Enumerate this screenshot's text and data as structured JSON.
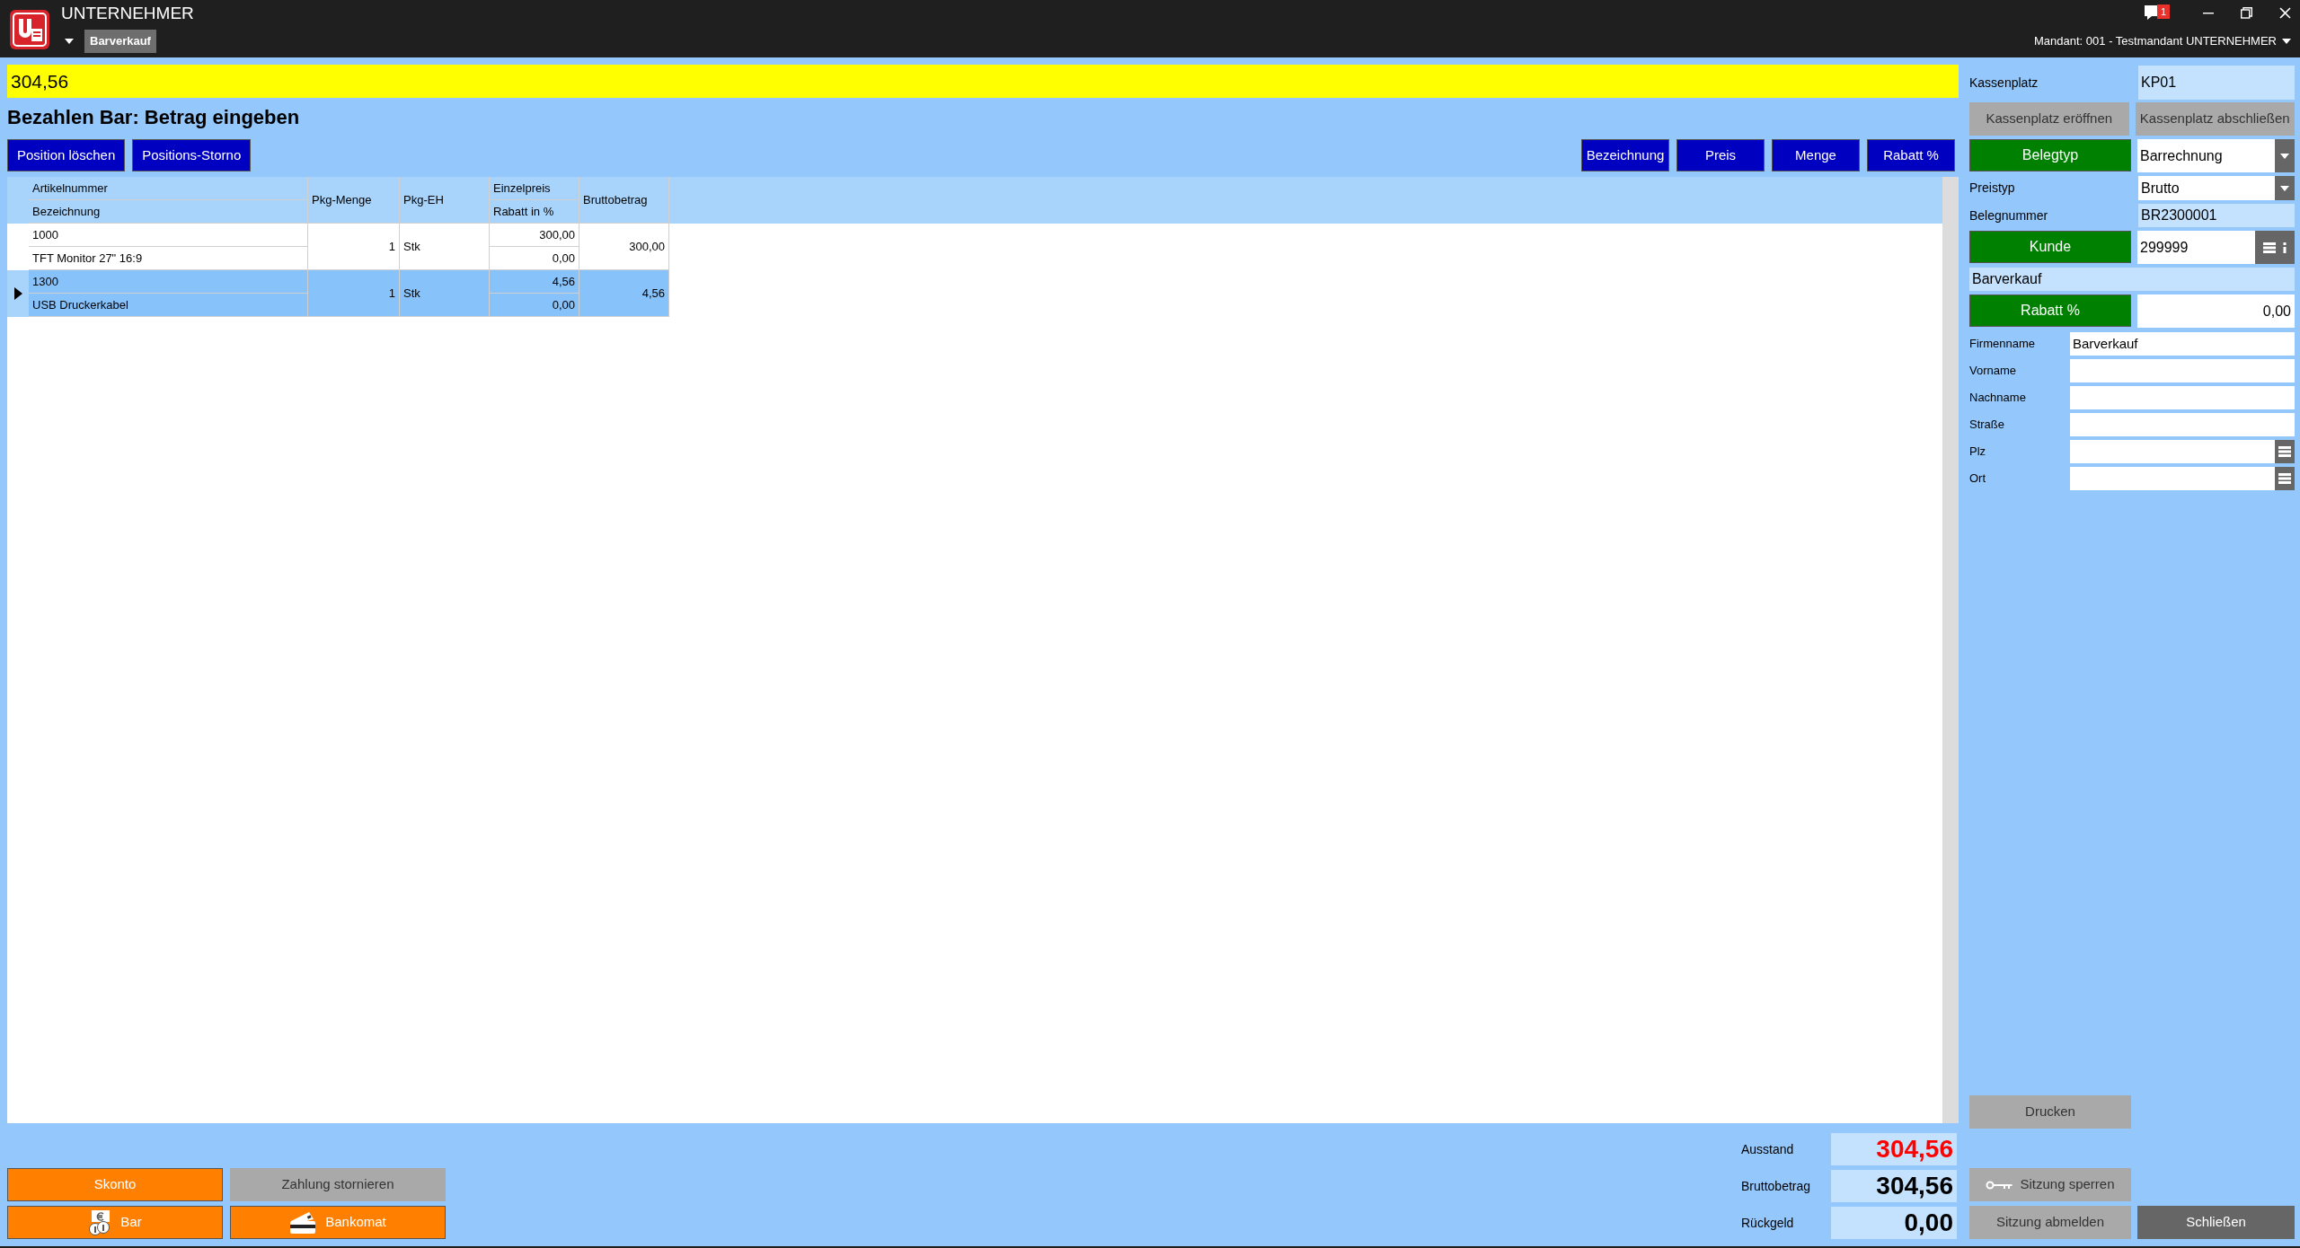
{
  "window": {
    "title": "UNTERNEHMER",
    "tab": "Barverkauf",
    "notification_count": "1",
    "mandant": "Mandant: 001 - Testmandant UNTERNEHMER"
  },
  "amount_input": {
    "value": "304,56"
  },
  "prompt": "Bezahlen Bar: Betrag eingeben",
  "position_buttons": [
    "Position löschen",
    "Positions-Storno"
  ],
  "sort_buttons": [
    "Bezeichnung",
    "Preis",
    "Menge",
    "Rabatt %"
  ],
  "table": {
    "columns": {
      "artikelnummer": "Artikelnummer",
      "bezeichnung": "Bezeichnung",
      "pkg_menge": "Pkg-Menge",
      "pkg_eh": "Pkg-EH",
      "einzelpreis": "Einzelpreis",
      "rabatt": "Rabatt in %",
      "bruttobetrag": "Bruttobetrag"
    },
    "rows": [
      {
        "artikelnummer": "1000",
        "bezeichnung": "TFT Monitor 27\" 16:9",
        "pkg_menge": "1",
        "pkg_eh": "Stk",
        "einzelpreis": "300,00",
        "rabatt": "0,00",
        "bruttobetrag": "300,00",
        "selected": false
      },
      {
        "artikelnummer": "1300",
        "bezeichnung": "USB Druckerkabel",
        "pkg_menge": "1",
        "pkg_eh": "Stk",
        "einzelpreis": "4,56",
        "rabatt": "0,00",
        "bruttobetrag": "4,56",
        "selected": true
      }
    ]
  },
  "payment_buttons": [
    {
      "label": "Skonto",
      "kind": "plain",
      "disabled": false
    },
    {
      "label": "Zahlung stornieren",
      "kind": "plain",
      "disabled": true
    },
    {
      "label": "Bar",
      "kind": "cash",
      "disabled": false
    },
    {
      "label": "Bankomat",
      "kind": "card",
      "disabled": false
    }
  ],
  "totals": [
    {
      "label": "Ausstand",
      "value": "304,56",
      "color": "#ff0000"
    },
    {
      "label": "Bruttobetrag",
      "value": "304,56",
      "color": "#000000"
    },
    {
      "label": "Rückgeld",
      "value": "0,00",
      "color": "#000000"
    }
  ],
  "side_panel": {
    "register": {
      "label": "Kassenplatz",
      "value": "KP01"
    },
    "register_buttons": [
      {
        "label": "Kassenplatz eröffnen",
        "disabled": true
      },
      {
        "label": "Kassenplatz abschließen",
        "disabled": true
      }
    ],
    "document_type": {
      "button": "Belegtyp",
      "value": "Barrechnung"
    },
    "price_type": {
      "label": "Preistyp",
      "value": "Brutto"
    },
    "document_number": {
      "label": "Belegnummer",
      "value": "BR2300001"
    },
    "customer": {
      "button": "Kunde",
      "value": "299999",
      "name": "Barverkauf"
    },
    "discount": {
      "button": "Rabatt %",
      "value": "0,00"
    },
    "address_fields": [
      {
        "label": "Firmenname",
        "value": "Barverkauf",
        "lookup": false
      },
      {
        "label": "Vorname",
        "lookup": false
      },
      {
        "label": "Nachname",
        "lookup": false
      },
      {
        "label": "Straße",
        "lookup": false
      },
      {
        "label": "Plz",
        "lookup": true
      },
      {
        "label": "Ort",
        "lookup": true
      }
    ],
    "print_button": {
      "label": "Drucken",
      "disabled": true
    },
    "session_buttons": [
      {
        "label": "Sitzung sperren",
        "kind": "lock"
      },
      {
        "label": "Sitzung abmelden",
        "kind": "plain"
      }
    ],
    "close_button": {
      "label": "Schließen"
    }
  }
}
